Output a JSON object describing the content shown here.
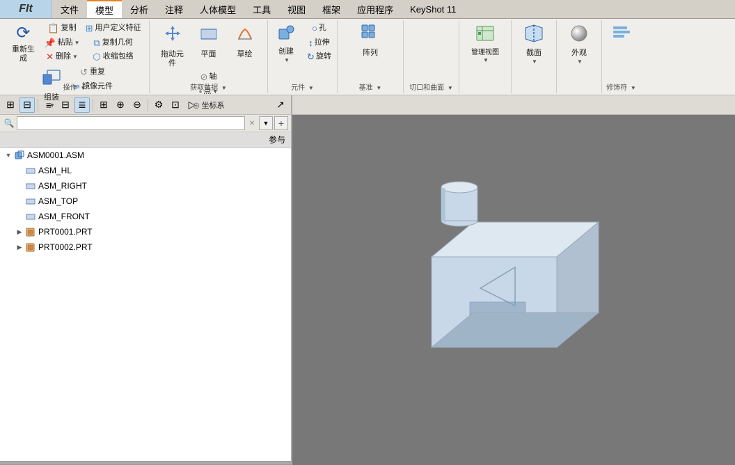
{
  "app": {
    "title": "FIt"
  },
  "menubar": {
    "items": [
      {
        "id": "file",
        "label": "文件"
      },
      {
        "id": "model",
        "label": "模型",
        "active": true
      },
      {
        "id": "analysis",
        "label": "分析"
      },
      {
        "id": "annotation",
        "label": "注释"
      },
      {
        "id": "human_model",
        "label": "人体模型"
      },
      {
        "id": "tools",
        "label": "工具"
      },
      {
        "id": "view",
        "label": "视图"
      },
      {
        "id": "frame",
        "label": "框架"
      },
      {
        "id": "apps",
        "label": "应用程序"
      },
      {
        "id": "keyshot",
        "label": "KeyShot 11"
      }
    ]
  },
  "toolbar": {
    "groups": [
      {
        "id": "ops",
        "label": "操作",
        "buttons": [
          {
            "id": "regenerate",
            "label": "重新生成",
            "icon": "⟳"
          },
          {
            "id": "copy",
            "label": "复制",
            "icon": "📋"
          },
          {
            "id": "paste",
            "label": "粘贴",
            "icon": "📌"
          },
          {
            "id": "delete",
            "label": "删除",
            "icon": "✕"
          },
          {
            "id": "user_feature",
            "label": "用户定义特征",
            "icon": "⊞"
          },
          {
            "id": "copy_geo",
            "label": "复制几何",
            "icon": "⧉"
          },
          {
            "id": "shrink_wrap",
            "label": "收缩包络",
            "icon": "⬡"
          },
          {
            "id": "group",
            "label": "组装",
            "icon": "🔧"
          },
          {
            "id": "restore",
            "label": "重复",
            "icon": "↺"
          },
          {
            "id": "mirror",
            "label": "镜像元件",
            "icon": "⇌"
          }
        ]
      },
      {
        "id": "getData",
        "label": "获取数据",
        "buttons": [
          {
            "id": "move",
            "label": "拖动元件",
            "icon": "✥"
          },
          {
            "id": "plane",
            "label": "平面",
            "icon": "▭"
          },
          {
            "id": "grass",
            "label": "草绘",
            "icon": "✏"
          },
          {
            "id": "shaft",
            "label": "轴",
            "icon": "⊘"
          },
          {
            "id": "point",
            "label": "点",
            "icon": "·"
          },
          {
            "id": "coords",
            "label": "坐标系",
            "icon": "⊕"
          }
        ]
      },
      {
        "id": "element",
        "label": "元件",
        "buttons": [
          {
            "id": "create",
            "label": "创建",
            "icon": "✚"
          },
          {
            "id": "hole",
            "label": "孔",
            "icon": "○"
          },
          {
            "id": "stretch",
            "label": "拉伸",
            "icon": "↕"
          },
          {
            "id": "rotate",
            "label": "旋转",
            "icon": "↻"
          }
        ]
      },
      {
        "id": "base",
        "label": "基准",
        "buttons": [
          {
            "id": "array",
            "label": "阵列",
            "icon": "⊞"
          },
          {
            "id": "mgmt_view",
            "label": "管理视图",
            "icon": "👁"
          },
          {
            "id": "section",
            "label": "截面",
            "icon": "✂"
          },
          {
            "id": "outer",
            "label": "外观",
            "icon": "◐"
          },
          {
            "id": "more",
            "label": "",
            "icon": "▶"
          }
        ]
      }
    ]
  },
  "panel_toolbar": {
    "buttons": [
      {
        "id": "tree_view",
        "icon": "≡",
        "label": "模型树视图"
      },
      {
        "id": "layer_view",
        "icon": "⊟",
        "label": "层视图"
      },
      {
        "id": "details",
        "icon": "≣",
        "label": "详情"
      },
      {
        "id": "columns",
        "icon": "⊞",
        "label": "列"
      },
      {
        "id": "expand_all",
        "icon": "⊕",
        "label": "全部展开"
      },
      {
        "id": "collapse_all",
        "icon": "⊖",
        "label": "全部折叠"
      },
      {
        "id": "settings",
        "icon": "⚙",
        "label": "设置"
      },
      {
        "id": "filter",
        "icon": "⊡",
        "label": "过滤"
      },
      {
        "id": "more2",
        "icon": "▷",
        "label": "更多"
      }
    ]
  },
  "search": {
    "placeholder": "",
    "value": ""
  },
  "column_header": {
    "label": "参与"
  },
  "tree": {
    "items": [
      {
        "id": "asm0001",
        "label": "ASM0001.ASM",
        "type": "asm",
        "level": 0,
        "expanded": true,
        "has_children": true
      },
      {
        "id": "asm_hl",
        "label": "ASM_HL",
        "type": "plane",
        "level": 1,
        "expanded": false,
        "has_children": false
      },
      {
        "id": "asm_right",
        "label": "ASM_RIGHT",
        "type": "plane",
        "level": 1,
        "expanded": false,
        "has_children": false
      },
      {
        "id": "asm_top",
        "label": "ASM_TOP",
        "type": "plane",
        "level": 1,
        "expanded": false,
        "has_children": false
      },
      {
        "id": "asm_front",
        "label": "ASM_FRONT",
        "type": "plane",
        "level": 1,
        "expanded": false,
        "has_children": false
      },
      {
        "id": "prt0001",
        "label": "PRT0001.PRT",
        "type": "prt",
        "level": 1,
        "expanded": false,
        "has_children": true
      },
      {
        "id": "prt0002",
        "label": "PRT0002.PRT",
        "type": "prt",
        "level": 1,
        "expanded": false,
        "has_children": true
      }
    ]
  },
  "viewport": {
    "background": "#787878"
  },
  "status": {
    "text": ""
  }
}
